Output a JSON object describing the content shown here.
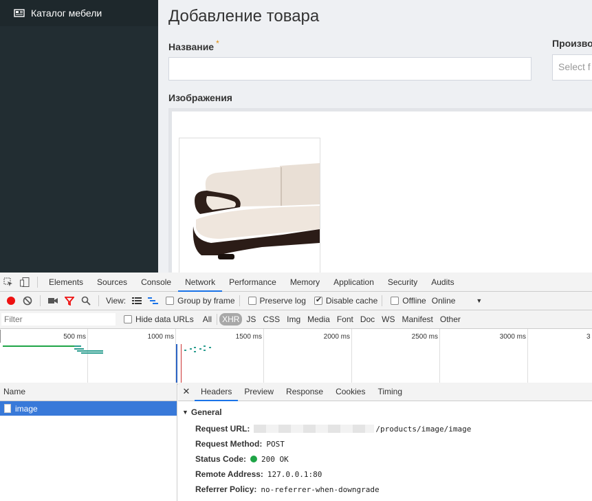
{
  "sidebar": {
    "menu_label": "Каталог мебели",
    "icon": "newspaper-icon"
  },
  "main": {
    "title": "Добавление товара",
    "name_label": "Название",
    "name_required": "*",
    "name_value": "",
    "manufacturer_label": "Произво",
    "manufacturer_placeholder": "Select f",
    "images_label": "Изображения",
    "image_alt": "sofa"
  },
  "devtools": {
    "tabs": [
      "Elements",
      "Sources",
      "Console",
      "Network",
      "Performance",
      "Memory",
      "Application",
      "Security",
      "Audits"
    ],
    "active_tab": "Network",
    "toolbar": {
      "view_label": "View:",
      "group_by_frame": "Group by frame",
      "preserve_log": "Preserve log",
      "disable_cache": "Disable cache",
      "offline": "Offline",
      "throttle": "Online"
    },
    "filter": {
      "placeholder": "Filter",
      "hide_data_urls": "Hide data URLs",
      "types": [
        "All",
        "XHR",
        "JS",
        "CSS",
        "Img",
        "Media",
        "Font",
        "Doc",
        "WS",
        "Manifest",
        "Other"
      ],
      "active_type": "XHR"
    },
    "timeline_labels": [
      "500 ms",
      "1000 ms",
      "1500 ms",
      "2000 ms",
      "2500 ms",
      "3000 ms",
      "3"
    ],
    "name_header": "Name",
    "request_name": "image",
    "detail_tabs": [
      "Headers",
      "Preview",
      "Response",
      "Cookies",
      "Timing"
    ],
    "active_detail_tab": "Headers",
    "general_label": "General",
    "headers": {
      "request_url_key": "Request URL:",
      "request_url_value": "/products/image/image",
      "method_key": "Request Method:",
      "method_value": "POST",
      "status_key": "Status Code:",
      "status_value": "200 OK",
      "remote_key": "Remote Address:",
      "remote_value": "127.0.0.1:80",
      "referrer_key": "Referrer Policy:",
      "referrer_value": "no-referrer-when-downgrade"
    }
  }
}
